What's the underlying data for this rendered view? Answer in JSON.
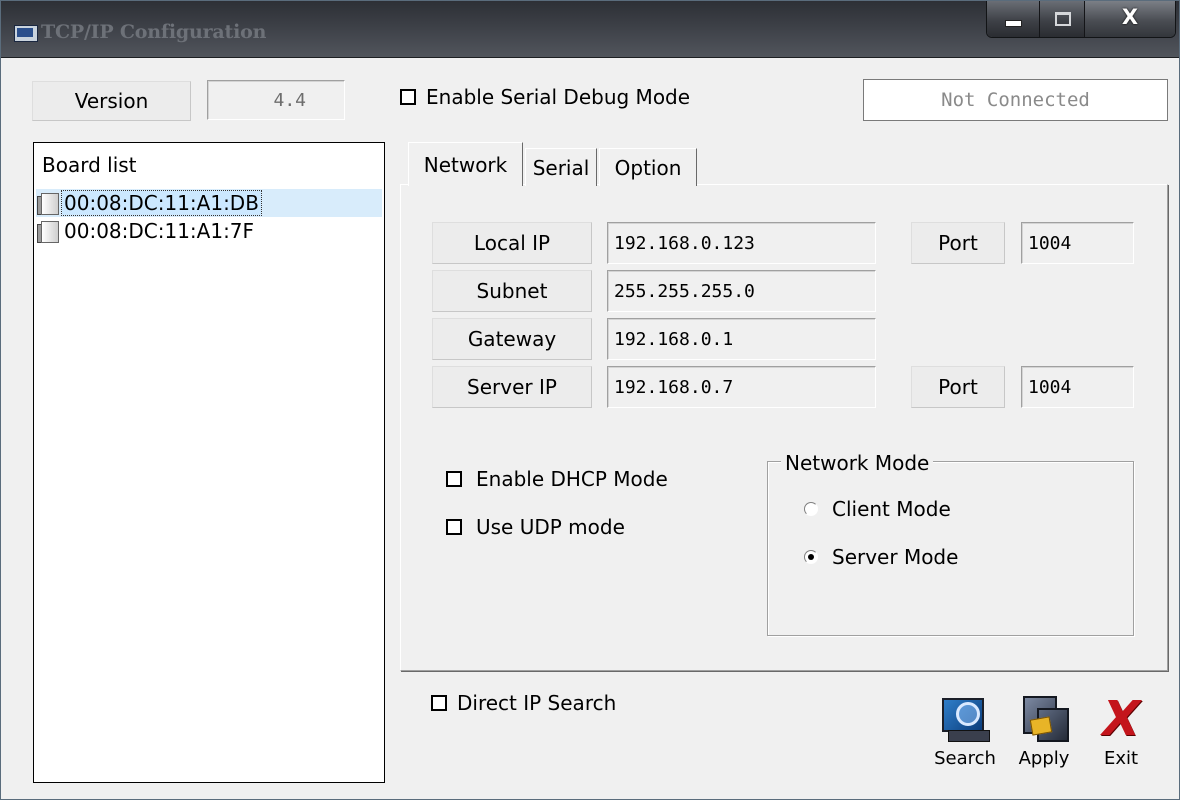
{
  "window": {
    "title": "TCP/IP Configuration",
    "close_glyph": "X"
  },
  "top": {
    "version_label": "Version",
    "version_value": "4.4",
    "serial_debug_label": "Enable Serial Debug Mode",
    "serial_debug_checked": false,
    "connection_status": "Not Connected"
  },
  "board_list": {
    "header": "Board list",
    "items": [
      {
        "mac": "00:08:DC:11:A1:DB",
        "selected": true
      },
      {
        "mac": "00:08:DC:11:A1:7F",
        "selected": false
      }
    ]
  },
  "tabs": [
    {
      "label": "Network",
      "active": true
    },
    {
      "label": "Serial",
      "active": false
    },
    {
      "label": "Option",
      "active": false
    }
  ],
  "network": {
    "local_ip_label": "Local IP",
    "local_ip": "192.168.0.123",
    "local_port_label": "Port",
    "local_port": "1004",
    "subnet_label": "Subnet",
    "subnet": "255.255.255.0",
    "gateway_label": "Gateway",
    "gateway": "192.168.0.1",
    "server_ip_label": "Server IP",
    "server_ip": "192.168.0.7",
    "server_port_label": "Port",
    "server_port": "1004",
    "dhcp_label": "Enable DHCP Mode",
    "dhcp_checked": false,
    "udp_label": "Use UDP mode",
    "udp_checked": false,
    "mode_group_title": "Network Mode",
    "client_mode_label": "Client Mode",
    "server_mode_label": "Server Mode",
    "selected_mode": "Server Mode"
  },
  "bottom": {
    "direct_ip_label": "Direct IP Search",
    "direct_ip_checked": false,
    "search_label": "Search",
    "apply_label": "Apply",
    "exit_label": "Exit",
    "exit_glyph": "X"
  }
}
